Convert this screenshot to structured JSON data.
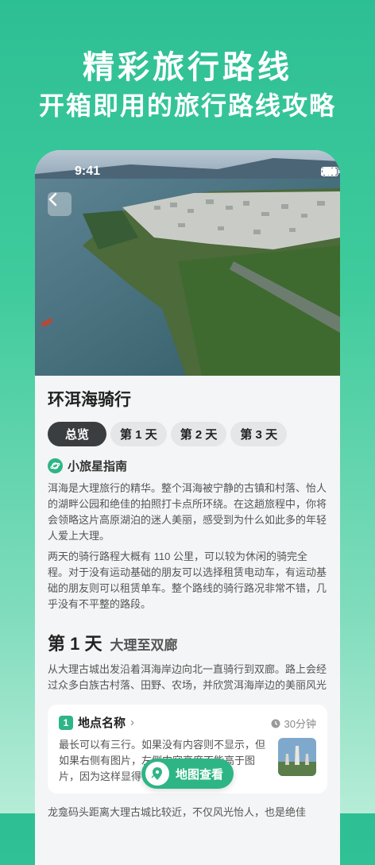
{
  "headline": {
    "title": "精彩旅行路线",
    "subtitle": "开箱即用的旅行路线攻略"
  },
  "status_bar": {
    "time": "9:41"
  },
  "route": {
    "title": "环洱海骑行"
  },
  "tabs": [
    {
      "label": "总览",
      "active": true
    },
    {
      "label": "第 1 天",
      "active": false
    },
    {
      "label": "第 2 天",
      "active": false
    },
    {
      "label": "第 3 天",
      "active": false
    }
  ],
  "guide": {
    "name": "小旅星指南",
    "paragraphs": [
      "洱海是大理旅行的精华。整个洱海被宁静的古镇和村落、怡人的湖畔公园和绝佳的拍照打卡点所环绕。在这趟旅程中，你将会领略这片高原湖泊的迷人美丽，感受到为什么如此多的年轻人爱上大理。",
      "两天的骑行路程大概有 110 公里，可以较为休闲的骑完全程。对于没有运动基础的朋友可以选择租赁电动车，有运动基础的朋友则可以租赁单车。整个路线的骑行路况非常不错，几乎没有不平整的路段。"
    ]
  },
  "day1": {
    "label": "第 1 天",
    "subtitle": "大理至双廊",
    "description": "从大理古城出发沿着洱海岸边向北一直骑行到双廊。路上会经过众多白族古村落、田野、农场，并欣赏洱海岸边的美丽风光"
  },
  "place_card": {
    "index": "1",
    "name": "地点名称",
    "duration": "30分钟",
    "text": "最长可以有三行。如果没有内容则不显示，但如果右侧有图片，左侧内容高度不能高于图片，因为这样显得很空旷无个..."
  },
  "bottom_text": "龙龛码头距离大理古城比较近，不仅风光怡人，也是绝佳",
  "map_button": {
    "label": "地图查看"
  },
  "colors": {
    "accent": "#2eb586",
    "bg_top": "#2dbf94",
    "active_tab": "#3b3e41"
  },
  "icons": [
    "back-chevron-icon",
    "signal-icon",
    "wifi-icon",
    "battery-icon",
    "planet-logo-icon",
    "chevron-right-icon",
    "clock-icon",
    "map-pin-icon"
  ]
}
